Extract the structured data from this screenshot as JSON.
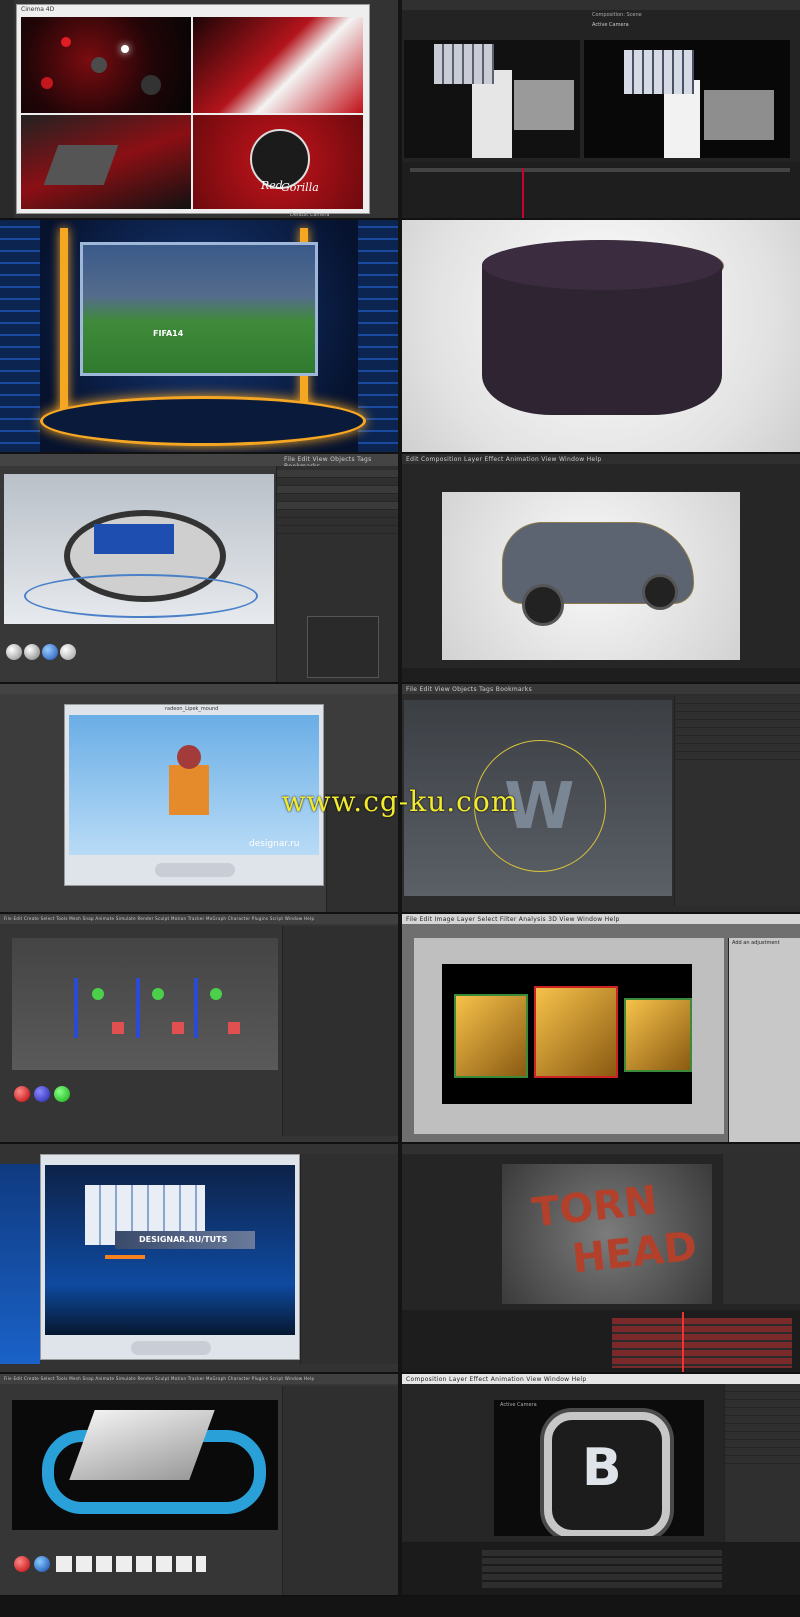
{
  "tiles": {
    "red_gorilla": {
      "window_title": "Cinema 4D",
      "logo_line1": "Red",
      "logo_line2": "Gorilla",
      "footer": "Default Camera"
    },
    "cube_fist": {
      "panel_title": "Composition: Scene",
      "camera_label": "Active Camera"
    },
    "fifa_studio": {
      "screen_brand": "FIFA14"
    },
    "pouf": {},
    "gear_logo": {
      "menu": "File  Edit  View  Objects  Tags  Bookmarks"
    },
    "car": {
      "menu": "Edit  Composition  Layer  Effect  Animation  View  Window  Help"
    },
    "player_window": {
      "title": "radeon_Lipek_mound",
      "brand": "designar.ru"
    },
    "w_logo": {
      "menu": "File  Edit  View  Objects  Tags  Bookmarks"
    },
    "pendulum": {
      "menu": "File  Edit  Create  Select  Tools  Mesh  Snap  Animate  Simulate  Render  Sculpt  Motion Tracker  MoGraph  Character  Plugins  Script  Window  Help"
    },
    "gold_cubes": {
      "menu": "File  Edit  Image  Layer  Select  Filter  Analysis  3D  View  Window  Help",
      "panel_title": "Add an adjustment"
    },
    "studio_player": {
      "banner": "DESIGNAR.RU/TUTS"
    },
    "torn_head": {
      "line1": "TORN",
      "line2": "HEAD"
    },
    "ribbons": {
      "menu": "File  Edit  Create  Select  Tools  Mesh  Snap  Animate  Simulate  Render  Sculpt  Motion Tracker  MoGraph  Character  Plugins  Script  Window  Help"
    },
    "b_logo": {
      "menu": "Composition  Layer  Effect  Animation  View  Window  Help",
      "camera_label": "Active Camera",
      "letter": "B"
    }
  },
  "watermark": "www.cg-ku.com",
  "colors": {
    "accent_red": "#d21f26",
    "watermark_yellow": "#f2ea2c",
    "ui_dark": "#2b2b2b"
  }
}
